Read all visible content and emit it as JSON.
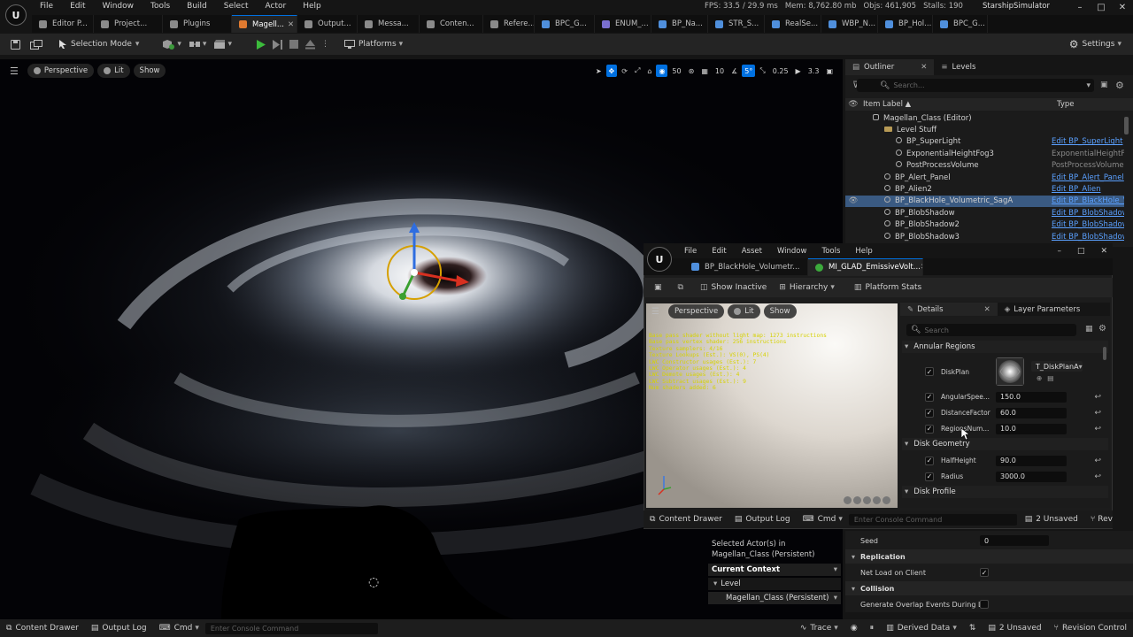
{
  "menubar": {
    "logo": "U",
    "items": [
      "File",
      "Edit",
      "Window",
      "Tools",
      "Build",
      "Select",
      "Actor",
      "Help"
    ],
    "stats": {
      "fps": "FPS: 33.5",
      "ms": "/ 29.9 ms",
      "mem": "Mem: 8,762.80 mb",
      "objs": "Objs: 461,905",
      "stalls": "Stalls: 190"
    },
    "project": "StarshipSimulator",
    "window_controls": [
      "–",
      "□",
      "✕"
    ]
  },
  "tabs": [
    {
      "label": "Editor P...",
      "color": "#8a8a8a"
    },
    {
      "label": "Project...",
      "color": "#8a8a8a"
    },
    {
      "label": "Plugins",
      "color": "#8a8a8a"
    },
    {
      "label": "Magell...",
      "color": "#e07a30",
      "active": true
    },
    {
      "label": "Output...",
      "color": "#8a8a8a"
    },
    {
      "label": "Messa...",
      "color": "#8a8a8a"
    },
    {
      "label": "Conten...",
      "color": "#8a8a8a"
    },
    {
      "label": "Refere...",
      "color": "#8a8a8a"
    },
    {
      "label": "BPC_G...",
      "color": "#4f8fdc"
    },
    {
      "label": "ENUM_...",
      "color": "#7a6fd0"
    },
    {
      "label": "BP_Na...",
      "color": "#4f8fdc"
    },
    {
      "label": "STR_S...",
      "color": "#4f8fdc"
    },
    {
      "label": "RealSe...",
      "color": "#4f8fdc"
    },
    {
      "label": "WBP_N...",
      "color": "#4f8fdc"
    },
    {
      "label": "BP_Hol...",
      "color": "#4f8fdc"
    },
    {
      "label": "BPC_G...",
      "color": "#4f8fdc"
    }
  ],
  "toolbar": {
    "mode": "Selection Mode",
    "platforms": "Platforms",
    "settings": "Settings"
  },
  "viewport": {
    "perspective": "Perspective",
    "lit": "Lit",
    "show": "Show",
    "grid": "10",
    "angle": "5°",
    "scale": "0.25",
    "camspeed": "3.3",
    "speed": "50"
  },
  "outliner": {
    "tab": "Outliner",
    "levels_tab": "Levels",
    "search_placeholder": "Search...",
    "col_label": "Item Label ▲",
    "col_type": "Type",
    "rows": [
      {
        "label": "Magellan_Class (Editor)",
        "type": "",
        "indent": 1,
        "kind": "world"
      },
      {
        "label": "Level Stuff",
        "type": "",
        "indent": 2,
        "kind": "folder"
      },
      {
        "label": "BP_SuperLight",
        "type": "Edit BP_SuperLight",
        "indent": 3,
        "kind": "actor",
        "link": true
      },
      {
        "label": "ExponentialHeightFog3",
        "type": "ExponentialHeightFo",
        "indent": 3,
        "kind": "actor",
        "link": false
      },
      {
        "label": "PostProcessVolume",
        "type": "PostProcessVolume",
        "indent": 3,
        "kind": "actor",
        "link": false
      },
      {
        "label": "BP_Alert_Panel",
        "type": "Edit BP_Alert_Panel",
        "indent": 2,
        "kind": "actor",
        "link": true
      },
      {
        "label": "BP_Alien2",
        "type": "Edit BP_Alien",
        "indent": 2,
        "kind": "actor",
        "link": true
      },
      {
        "label": "BP_BlackHole_Volumetric_SagA",
        "type": "Edit BP_BlackHole_V",
        "indent": 2,
        "kind": "actor",
        "link": true,
        "selected": true
      },
      {
        "label": "BP_BlobShadow",
        "type": "Edit BP_BlobShadow",
        "indent": 2,
        "kind": "actor",
        "link": true
      },
      {
        "label": "BP_BlobShadow2",
        "type": "Edit BP_BlobShadow",
        "indent": 2,
        "kind": "actor",
        "link": true
      },
      {
        "label": "BP_BlobShadow3",
        "type": "Edit BP_BlobShadow",
        "indent": 2,
        "kind": "actor",
        "link": true
      }
    ]
  },
  "material": {
    "menu": [
      "File",
      "Edit",
      "Asset",
      "Window",
      "Tools",
      "Help"
    ],
    "tab1": "BP_BlackHole_Volumetr...",
    "tab2": "MI_GLAD_EmissiveVolt...",
    "show_inactive": "Show Inactive",
    "hierarchy": "Hierarchy",
    "platform_stats": "Platform Stats",
    "vp_perspective": "Perspective",
    "vp_lit": "Lit",
    "vp_show": "Show",
    "shader_stats": [
      "Base pass shader without light map: 1273 instructions",
      "Base pass vertex shader: 256 instructions",
      "Texture samplers: 4/16",
      "Texture Lookups (Est.): VS(0), PS(4)",
      "LWC Constructor usages (Est.): 7",
      "LWC Operator usages (Est.): 4",
      "LWC Demote usages (Est.): 4",
      "LWC Subtract usages (Est.): 9",
      "Num shaders added: 6"
    ],
    "details_tab": "Details",
    "layer_tab": "Layer Parameters",
    "search_placeholder": "Search",
    "sections": {
      "annular": "Annular Regions",
      "geometry": "Disk Geometry",
      "profile": "Disk Profile"
    },
    "diskplan": {
      "name": "DiskPlan",
      "texture": "T_DiskPlanA"
    },
    "params": [
      {
        "name": "AngularSpee...",
        "value": "150.0"
      },
      {
        "name": "DistanceFactor",
        "value": "60.0"
      },
      {
        "name": "RegionsNum...",
        "value": "10.0"
      }
    ],
    "geometry_params": [
      {
        "name": "HalfHeight",
        "value": "90.0"
      },
      {
        "name": "Radius",
        "value": "3000.0"
      }
    ],
    "bottom": {
      "content_drawer": "Content Drawer",
      "output_log": "Output Log",
      "cmd": "Cmd",
      "console_placeholder": "Enter Console Command",
      "unsaved": "2 Unsaved",
      "rev": "Rev"
    }
  },
  "details_main": {
    "seed_label": "Seed",
    "seed_value": "0",
    "replication": "Replication",
    "net_load": "Net Load on Client",
    "collision": "Collision",
    "overlap": "Generate Overlap Events During L..."
  },
  "context_popup": {
    "selected": "Selected Actor(s) in",
    "level_name": "Magellan_Class (Persistent)",
    "current_context": "Current Context",
    "level": "Level",
    "level_value": "Magellan_Class (Persistent)"
  },
  "bottombar": {
    "content_drawer": "Content Drawer",
    "output_log": "Output Log",
    "cmd": "Cmd",
    "console_placeholder": "Enter Console Command",
    "trace": "Trace",
    "derived": "Derived Data",
    "unsaved": "2 Unsaved",
    "revision": "Revision Control"
  }
}
